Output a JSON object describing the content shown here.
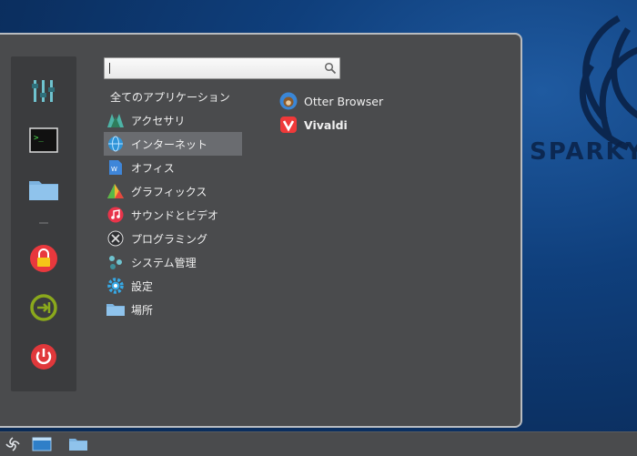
{
  "wallpaper": {
    "brand_text": "SPARKY"
  },
  "search": {
    "value": "",
    "placeholder": ""
  },
  "categories": {
    "all_label": "全てのアプリケーション",
    "items": [
      {
        "label": "アクセサリ",
        "icon": "accessories-icon"
      },
      {
        "label": "インターネット",
        "icon": "globe-icon",
        "active": true
      },
      {
        "label": "オフィス",
        "icon": "office-icon"
      },
      {
        "label": "グラフィックス",
        "icon": "graphics-icon"
      },
      {
        "label": "サウンドとビデオ",
        "icon": "music-note-icon"
      },
      {
        "label": "プログラミング",
        "icon": "programming-tools-icon"
      },
      {
        "label": "システム管理",
        "icon": "system-admin-icon"
      },
      {
        "label": "設定",
        "icon": "settings-gear-icon"
      },
      {
        "label": "場所",
        "icon": "folder-icon"
      }
    ]
  },
  "apps": [
    {
      "label": "Otter Browser",
      "icon": "otter-browser-icon"
    },
    {
      "label": "Vivaldi",
      "icon": "vivaldi-icon"
    }
  ],
  "sidebar": {
    "items": [
      {
        "icon": "mixer-settings-icon"
      },
      {
        "icon": "terminal-icon"
      },
      {
        "icon": "folder-icon"
      },
      {
        "icon": "lock-icon"
      },
      {
        "icon": "logout-icon"
      },
      {
        "icon": "power-icon"
      }
    ]
  },
  "colors": {
    "menu_bg": "#4a4b4d",
    "sidebar_bg": "#3b3c3e",
    "active_row": "#6a6c70",
    "lock_red": "#e8383d",
    "logout_green": "#8aa81c",
    "power_red": "#e0383b",
    "vivaldi_red": "#ef3939"
  }
}
